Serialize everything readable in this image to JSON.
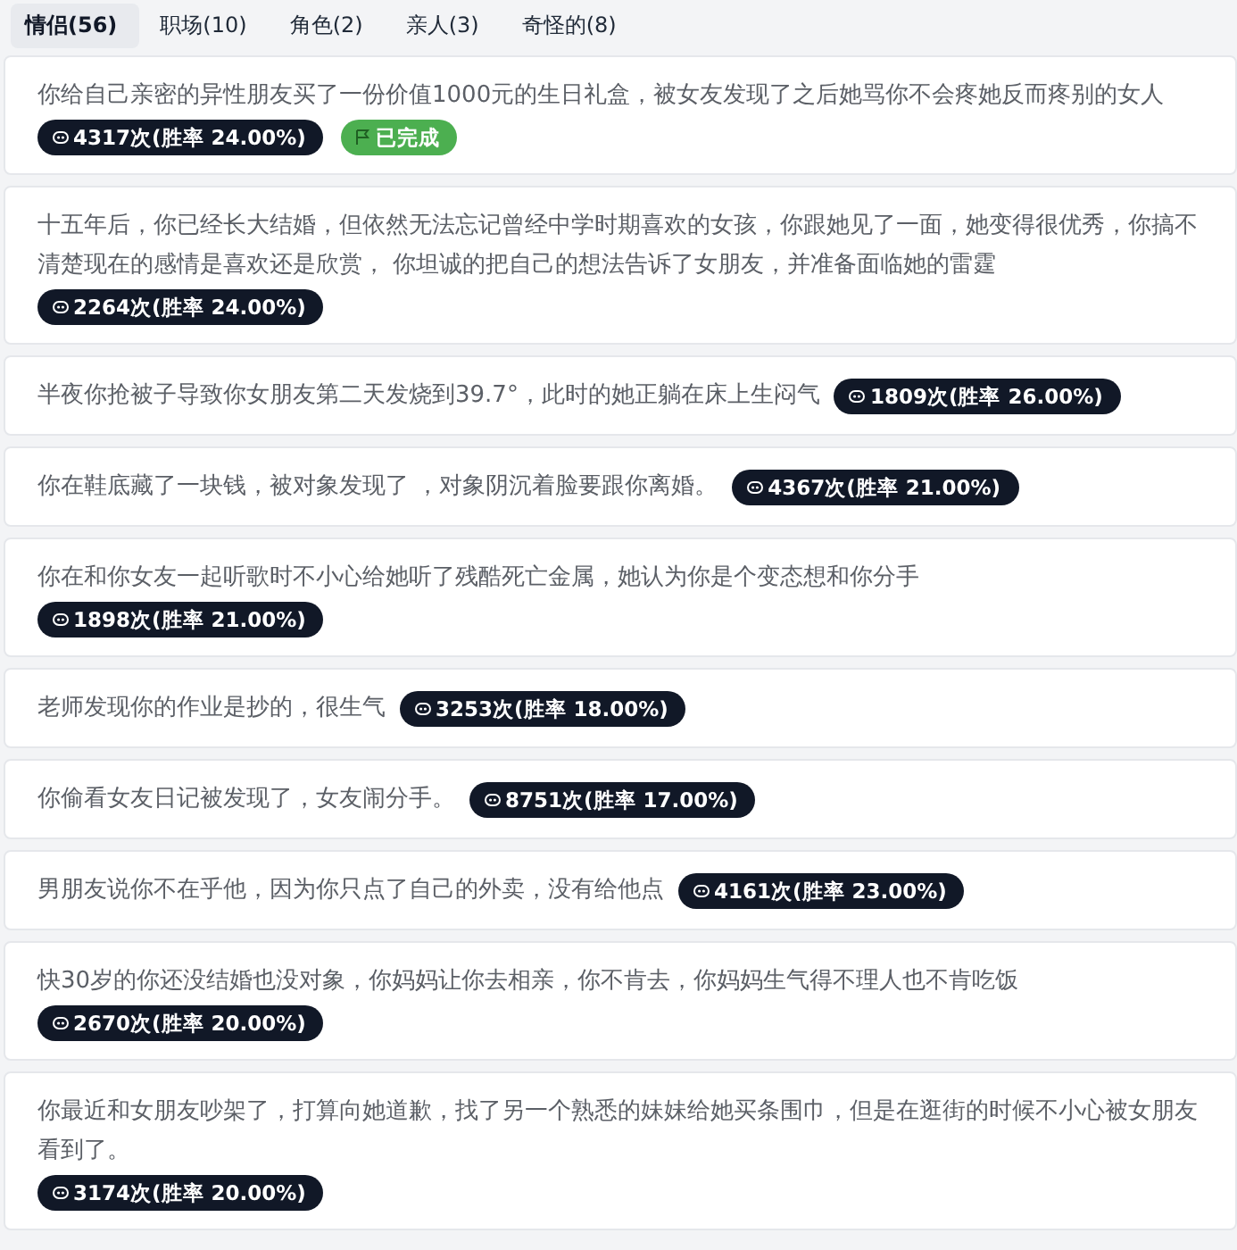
{
  "tabs": [
    {
      "label": "情侣(56)",
      "selected": true
    },
    {
      "label": "职场(10)",
      "selected": false
    },
    {
      "label": "角色(2)",
      "selected": false
    },
    {
      "label": "亲人(3)",
      "selected": false
    },
    {
      "label": "奇怪的(8)",
      "selected": false
    }
  ],
  "scenarios": [
    {
      "text": "你给自己亲密的异性朋友买了一份价值1000元的生日礼盒，被女友发现了之后她骂你不会疼她反而疼别的女人",
      "stats": "4317次(胜率 24.00%)",
      "completed": true,
      "status": "已完成"
    },
    {
      "text": "十五年后，你已经长大结婚，但依然无法忘记曾经中学时期喜欢的女孩，你跟她见了一面，她变得很优秀，你搞不清楚现在的感情是喜欢还是欣赏， 你坦诚的把自己的想法告诉了女朋友，并准备面临她的雷霆",
      "stats": "2264次(胜率 24.00%)",
      "completed": false
    },
    {
      "text": "半夜你抢被子导致你女朋友第二天发烧到39.7°，此时的她正躺在床上生闷气",
      "stats": "1809次(胜率 26.00%)",
      "completed": false
    },
    {
      "text": "你在鞋底藏了一块钱，被对象发现了 ，对象阴沉着脸要跟你离婚。",
      "stats": "4367次(胜率 21.00%)",
      "completed": false
    },
    {
      "text": "你在和你女友一起听歌时不小心给她听了残酷死亡金属，她认为你是个变态想和你分手",
      "stats": "1898次(胜率 21.00%)",
      "completed": false
    },
    {
      "text": "老师发现你的作业是抄的，很生气",
      "stats": "3253次(胜率 18.00%)",
      "completed": false
    },
    {
      "text": "你偷看女友日记被发现了，女友闹分手。",
      "stats": "8751次(胜率 17.00%)",
      "completed": false
    },
    {
      "text": "男朋友说你不在乎他，因为你只点了自己的外卖，没有给他点",
      "stats": "4161次(胜率 23.00%)",
      "completed": false
    },
    {
      "text": "快30岁的你还没结婚也没对象，你妈妈让你去相亲，你不肯去，你妈妈生气得不理人也不肯吃饭",
      "stats": "2670次(胜率 20.00%)",
      "completed": false
    },
    {
      "text": "你最近和女朋友吵架了，打算向她道歉，找了另一个熟悉的妹妹给她买条围巾，但是在逛街的时候不小心被女朋友看到了。",
      "stats": "3174次(胜率 20.00%)",
      "completed": false
    }
  ]
}
